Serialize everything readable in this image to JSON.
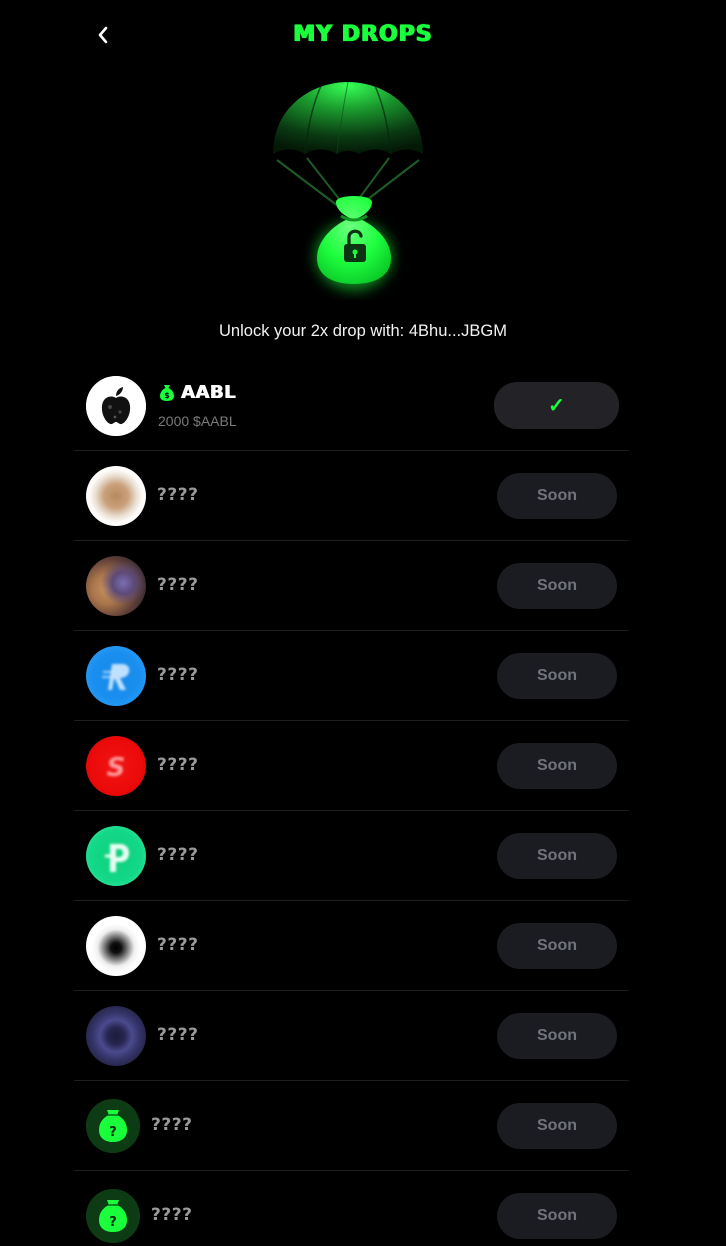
{
  "header": {
    "back_icon": "chevron-left-icon",
    "title": "MY DROPS"
  },
  "hero": {
    "icon": "parachute-money-bag-unlocked-icon",
    "accent_color": "#1aff3c"
  },
  "subtitle": "Unlock your 2x drop with: 4Bhu...JBGM",
  "drops": [
    {
      "name": "AABL",
      "name_icon": "money-bag-icon",
      "amount": "2000 $AABL",
      "status": "✓",
      "avatar": "apple-logo-avatar"
    },
    {
      "name": "????",
      "status": "Soon",
      "avatar": "blurred-egg-avatar"
    },
    {
      "name": "????",
      "status": "Soon",
      "avatar": "blurred-photo-avatar"
    },
    {
      "name": "????",
      "status": "Soon",
      "avatar": "blurred-blue-r-avatar"
    },
    {
      "name": "????",
      "status": "Soon",
      "avatar": "blurred-red-s-avatar"
    },
    {
      "name": "????",
      "status": "Soon",
      "avatar": "blurred-green-p-avatar"
    },
    {
      "name": "????",
      "status": "Soon",
      "avatar": "blurred-white-avatar"
    },
    {
      "name": "????",
      "status": "Soon",
      "avatar": "blurred-purple-ring-avatar"
    },
    {
      "name": "????",
      "status": "Soon",
      "avatar": "mystery-bag-avatar"
    },
    {
      "name": "????",
      "status": "Soon",
      "avatar": "mystery-bag-avatar"
    }
  ]
}
